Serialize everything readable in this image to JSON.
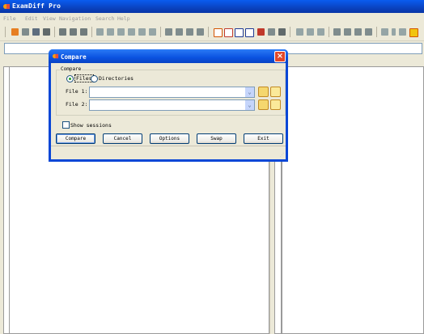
{
  "window": {
    "title": "ExamDiff Pro"
  },
  "menu": [
    "File",
    "Edit",
    "View",
    "Navigation",
    "Search",
    "Help"
  ],
  "toolbar_icons": [
    "open-compare-icon",
    "new-icon",
    "save-icon",
    "print-icon",
    "view1-icon",
    "view2-icon",
    "view3-icon",
    "edit1-icon",
    "edit2-icon",
    "edit3-icon",
    "edit4-icon",
    "edit5-icon",
    "edit6-icon",
    "undo-icon",
    "redo-icon",
    "next-icon",
    "prev-icon",
    "layout1-icon",
    "layout2-icon",
    "layout3-icon",
    "layout4-icon",
    "layout5-icon",
    "filter-icon",
    "block-icon",
    "up-icon",
    "updown-icon",
    "down-icon",
    "find-icon",
    "findnext-icon",
    "findprev-icon",
    "refresh-icon",
    "list-icon",
    "dropdown-icon",
    "options-icon",
    "settings-icon"
  ],
  "dialog": {
    "title": "Compare",
    "close": "×",
    "group_label": "Compare",
    "radio_files": "Files",
    "radio_dirs": "Directories",
    "file1_label": "File 1:",
    "file2_label": "File 2:",
    "file1_value": "",
    "file2_value": "",
    "show_sessions": "Show sessions",
    "buttons": {
      "compare": "Compare",
      "cancel": "Cancel",
      "options": "Options",
      "swap": "Swap",
      "exit": "Exit"
    }
  },
  "colors": {
    "titlebar": "#0a3fb9",
    "dialog_border": "#0a47d6",
    "close": "#e2482a"
  }
}
